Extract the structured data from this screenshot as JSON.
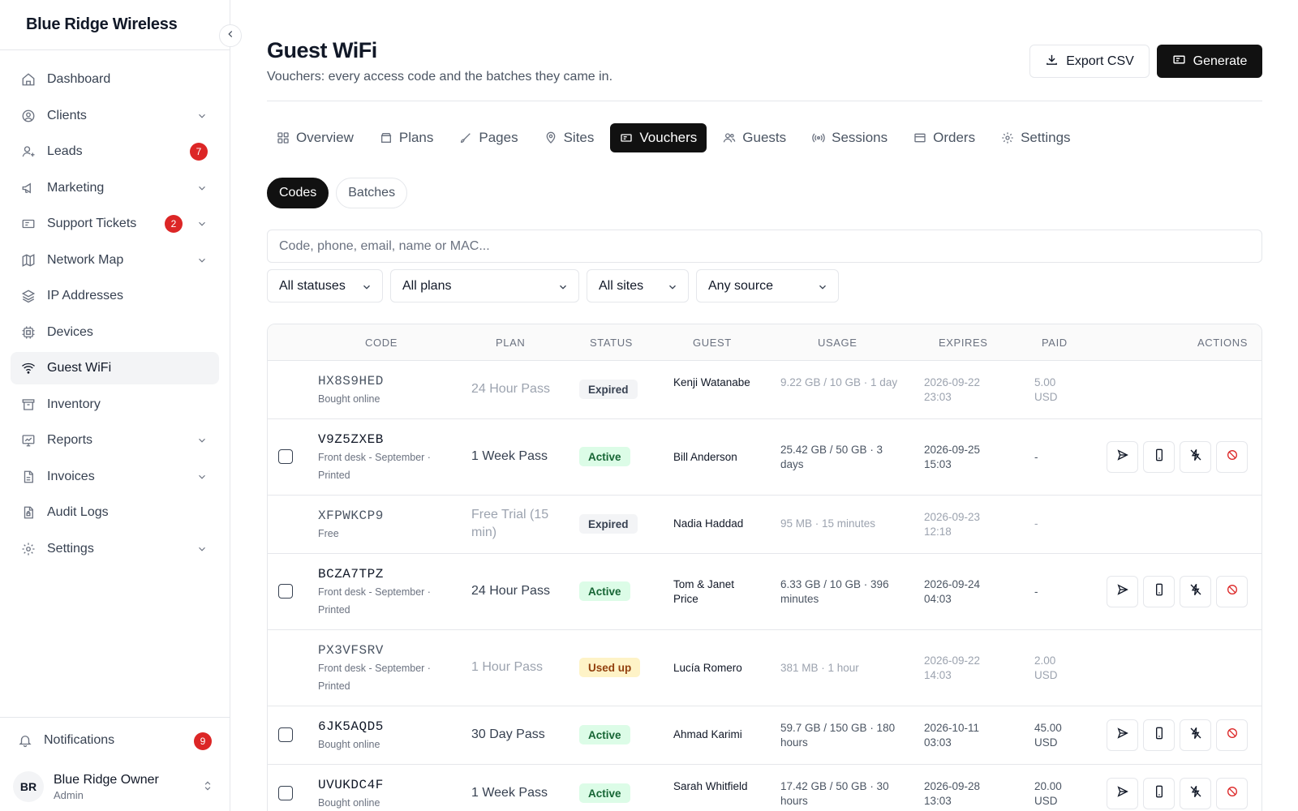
{
  "app": {
    "brand": "Blue Ridge Wireless"
  },
  "sidebar": {
    "items": [
      {
        "label": "Dashboard",
        "icon": "home-icon"
      },
      {
        "label": "Clients",
        "icon": "user-circle-icon",
        "expandable": true
      },
      {
        "label": "Leads",
        "icon": "user-plus-icon",
        "badge": "7"
      },
      {
        "label": "Marketing",
        "icon": "megaphone-icon",
        "expandable": true
      },
      {
        "label": "Support Tickets",
        "icon": "ticket-icon",
        "badge": "2",
        "expandable": true
      },
      {
        "label": "Network Map",
        "icon": "map-icon",
        "expandable": true
      },
      {
        "label": "IP Addresses",
        "icon": "layers-icon"
      },
      {
        "label": "Devices",
        "icon": "chip-icon"
      },
      {
        "label": "Guest WiFi",
        "icon": "wifi-icon",
        "active": true
      },
      {
        "label": "Inventory",
        "icon": "archive-icon"
      },
      {
        "label": "Reports",
        "icon": "chart-icon",
        "expandable": true
      },
      {
        "label": "Invoices",
        "icon": "file-icon",
        "expandable": true
      },
      {
        "label": "Audit Logs",
        "icon": "file-lock-icon"
      },
      {
        "label": "Settings",
        "icon": "gear-icon",
        "expandable": true
      }
    ],
    "notifications": {
      "label": "Notifications",
      "badge": "9"
    },
    "user": {
      "initials": "BR",
      "name": "Blue Ridge Owner",
      "role": "Admin"
    }
  },
  "header": {
    "title": "Guest WiFi",
    "subtitle": "Vouchers: every access code and the batches they came in.",
    "export_label": "Export CSV",
    "generate_label": "Generate"
  },
  "tabs": [
    {
      "label": "Overview",
      "icon": "grid-icon"
    },
    {
      "label": "Plans",
      "icon": "box-icon"
    },
    {
      "label": "Pages",
      "icon": "brush-icon"
    },
    {
      "label": "Sites",
      "icon": "pin-icon"
    },
    {
      "label": "Vouchers",
      "icon": "ticket-icon",
      "active": true
    },
    {
      "label": "Guests",
      "icon": "users-icon"
    },
    {
      "label": "Sessions",
      "icon": "broadcast-icon"
    },
    {
      "label": "Orders",
      "icon": "card-icon"
    },
    {
      "label": "Settings",
      "icon": "gear-icon"
    }
  ],
  "segments": {
    "codes": "Codes",
    "batches": "Batches"
  },
  "search": {
    "placeholder": "Code, phone, email, name or MAC..."
  },
  "filters": {
    "status": "All statuses",
    "plan": "All plans",
    "site": "All sites",
    "source": "Any source"
  },
  "table": {
    "headers": {
      "code": "CODE",
      "plan": "PLAN",
      "status": "STATUS",
      "guest": "GUEST",
      "usage": "USAGE",
      "expires": "EXPIRES",
      "paid": "PAID",
      "actions": "ACTIONS"
    },
    "rows": [
      {
        "code": "HX8S9HED",
        "source": "Bought online",
        "plan": "24 Hour Pass",
        "status": "Expired",
        "guest": "Kenji Watanabe",
        "usage": "9.22 GB / 10 GB · 1 day",
        "expires": "2026-09-22 23:03",
        "paid": "5.00 USD"
      },
      {
        "code": "V9Z5ZXEB",
        "source": "Front desk - September · Printed",
        "plan": "1 Week Pass",
        "status": "Active",
        "guest": "Bill Anderson",
        "usage": "25.42 GB / 50 GB · 3 days",
        "expires": "2026-09-25 15:03",
        "paid": "-"
      },
      {
        "code": "XFPWKCP9",
        "source": "Free",
        "plan": "Free Trial (15 min)",
        "status": "Expired",
        "guest": "Nadia Haddad",
        "usage": "95 MB · 15 minutes",
        "expires": "2026-09-23 12:18",
        "paid": "-"
      },
      {
        "code": "BCZA7TPZ",
        "source": "Front desk - September · Printed",
        "plan": "24 Hour Pass",
        "status": "Active",
        "guest": "Tom & Janet Price",
        "usage": "6.33 GB / 10 GB · 396 minutes",
        "expires": "2026-09-24 04:03",
        "paid": "-"
      },
      {
        "code": "PX3VFSRV",
        "source": "Front desk - September · Printed",
        "plan": "1 Hour Pass",
        "status": "Used up",
        "guest": "Lucía Romero",
        "usage": "381 MB · 1 hour",
        "expires": "2026-09-22 14:03",
        "paid": "2.00 USD"
      },
      {
        "code": "6JK5AQD5",
        "source": "Bought online",
        "plan": "30 Day Pass",
        "status": "Active",
        "guest": "Ahmad Karimi",
        "usage": "59.7 GB / 150 GB · 180 hours",
        "expires": "2026-10-11 03:03",
        "paid": "45.00 USD"
      },
      {
        "code": "UVUKDC4F",
        "source": "Bought online",
        "plan": "1 Week Pass",
        "status": "Active",
        "guest": "Sarah Whitfield",
        "usage": "17.42 GB / 50 GB · 30 hours",
        "expires": "2026-09-28 13:03",
        "paid": "20.00 USD"
      }
    ]
  }
}
